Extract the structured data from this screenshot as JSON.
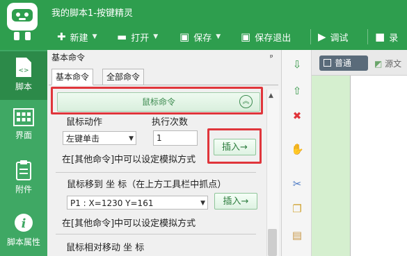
{
  "window": {
    "title": "我的脚本1-按键精灵"
  },
  "toolbar": {
    "new_label": "新建",
    "open_label": "打开",
    "save_label": "保存",
    "save_exit_label": "保存退出",
    "debug_label": "调试",
    "record_label": "录"
  },
  "nav": {
    "items": [
      {
        "label": "脚本",
        "icon": "script-icon"
      },
      {
        "label": "界面",
        "icon": "grid-icon"
      },
      {
        "label": "附件",
        "icon": "clipboard-icon"
      },
      {
        "label": "脚本属性",
        "icon": "info-icon"
      }
    ]
  },
  "panel": {
    "title": "基本命令",
    "pin": "ᵖ",
    "tabs": [
      "基本命令",
      "全部命令"
    ],
    "section_title": "鼠标命令",
    "mouse_action": {
      "label": "鼠标动作",
      "count_label": "执行次数",
      "selected": "左键单击",
      "count_value": "1",
      "insert_label": "插入→",
      "hint": "在[其他命令]中可以设定模拟方式"
    },
    "mouse_move": {
      "label": "鼠标移到   坐 标（在上方工具栏中抓点）",
      "selected": "P1 : X=1230 Y=161",
      "insert_label": "插入→",
      "hint": "在[其他命令]中可以设定模拟方式"
    },
    "mouse_relative": {
      "label": "鼠标相对移动     坐 标"
    }
  },
  "editor": {
    "normal_label": "普通",
    "source_label": "源文"
  },
  "colors": {
    "titlebar": "#2e9e4e",
    "nav": "#3fa864",
    "highlight": "#e0353b",
    "accent_text": "#3c8a4f"
  }
}
